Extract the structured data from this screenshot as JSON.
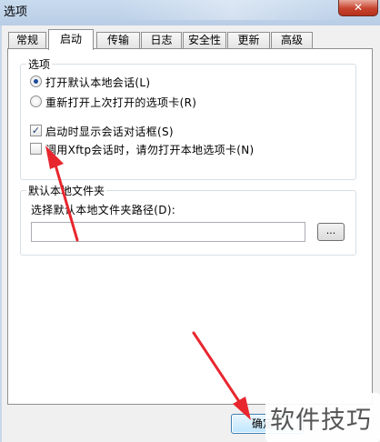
{
  "window": {
    "title": "选项",
    "close_label": "✕"
  },
  "tabs": [
    {
      "label": "常规"
    },
    {
      "label": "启动"
    },
    {
      "label": "传输"
    },
    {
      "label": "日志"
    },
    {
      "label": "安全性"
    },
    {
      "label": "更新"
    },
    {
      "label": "高级"
    }
  ],
  "options_group": {
    "label": "选项",
    "radio_1": {
      "label": "打开默认本地会话(L)",
      "checked": true
    },
    "radio_2": {
      "label": "重新打开上次打开的选项卡(R)",
      "checked": false
    },
    "check_1": {
      "label": "启动时显示会话对话框(S)",
      "checked": true
    },
    "check_2": {
      "label": "调用Xftp会话时，请勿打开本地选项卡(N)",
      "checked": false
    }
  },
  "folder_group": {
    "label": "默认本地文件夹",
    "path_label": "选择默认本地文件夹路径(D):",
    "path_value": "",
    "browse_label": "..."
  },
  "footer": {
    "ok_label": "确定"
  },
  "watermark": "软件技巧",
  "colors": {
    "annotation_arrow": "#e8262e",
    "dialog_bg": "#f0f0f0",
    "panel_bg": "#ffffff"
  }
}
